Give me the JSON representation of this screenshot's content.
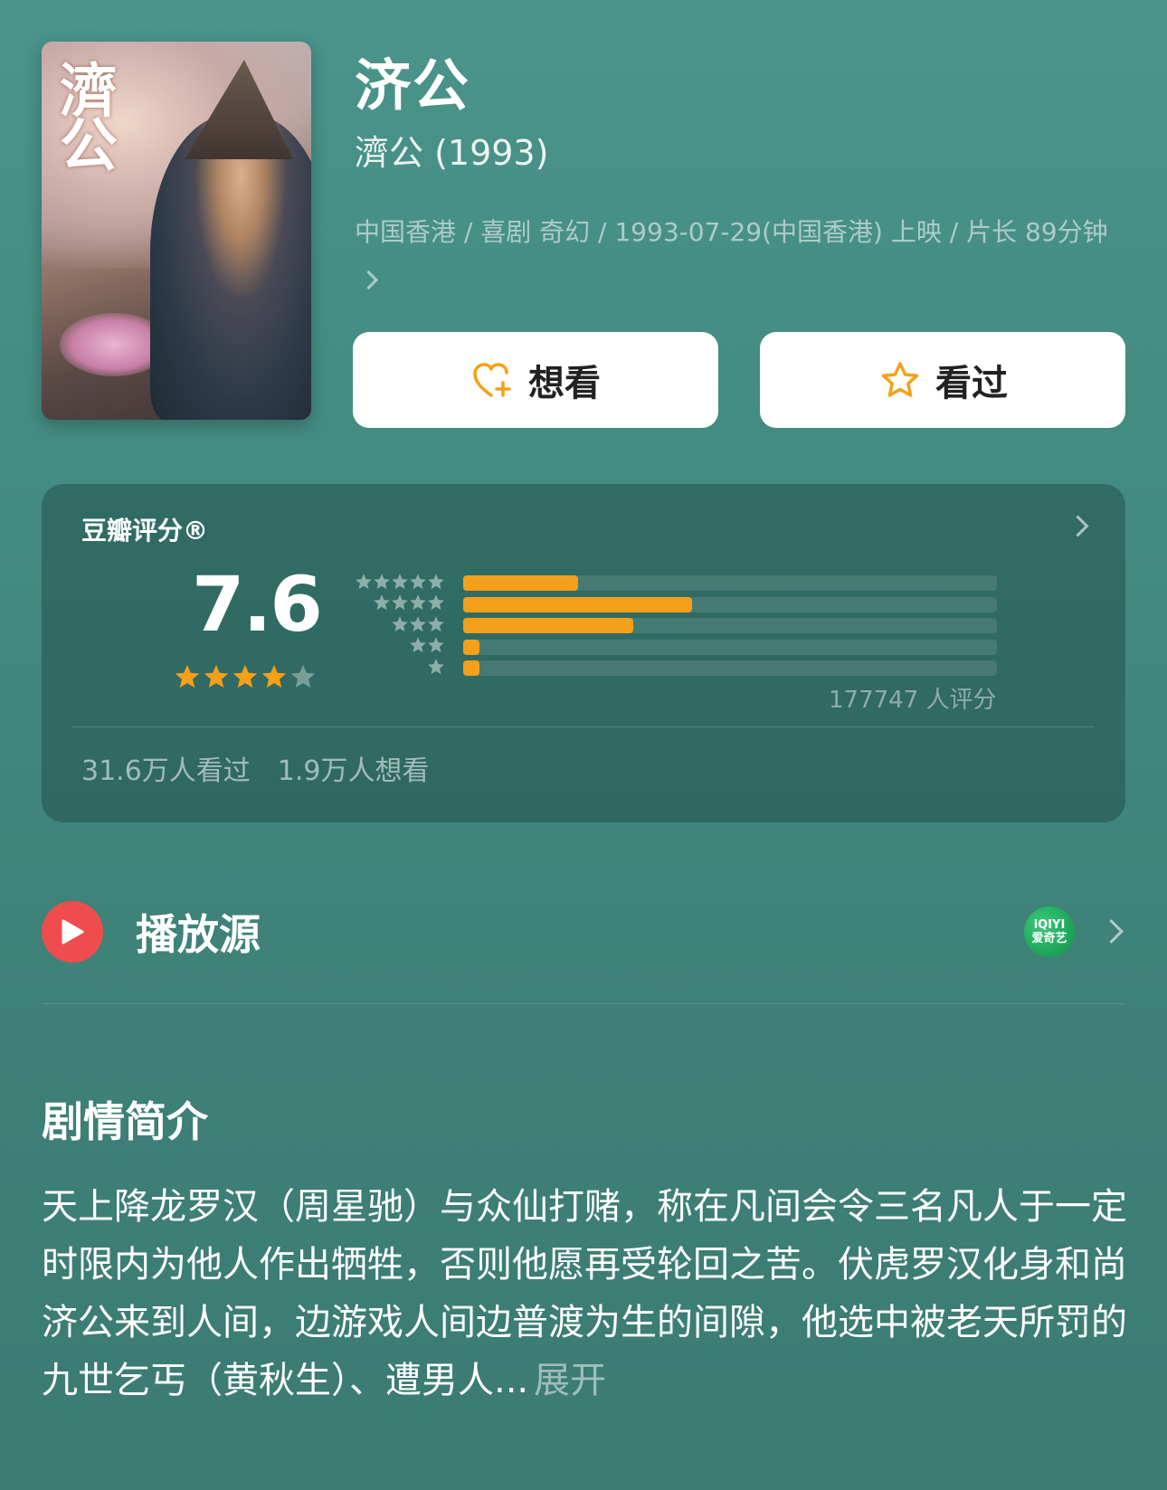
{
  "movie": {
    "title": "济公",
    "original_title": "濟公 (1993)",
    "meta_line": "中国香港 / 喜剧 奇幻 / 1993-07-29(中国香港) 上映 / 片长 89分钟",
    "poster_text": "濟公"
  },
  "actions": {
    "want_label": "想看",
    "seen_label": "看过",
    "want_icon": "heart-plus-icon",
    "seen_icon": "star-outline-icon",
    "icon_color": "#f5a01a"
  },
  "rating": {
    "label": "豆瓣评分®",
    "score": "7.6",
    "stars": 4,
    "max_stars": 5,
    "distribution": [
      {
        "stars": 5,
        "fraction": 0.215
      },
      {
        "stars": 4,
        "fraction": 0.428
      },
      {
        "stars": 3,
        "fraction": 0.318
      },
      {
        "stars": 2,
        "fraction": 0.03
      },
      {
        "stars": 1,
        "fraction": 0.03
      }
    ],
    "count_text": "177747 人评分",
    "seen_count": "31.6万人看过",
    "want_count": "1.9万人想看",
    "bar_color": "#f5a01a"
  },
  "source": {
    "label": "播放源",
    "provider_line1": "iQIYI",
    "provider_line2": "爱奇艺"
  },
  "synopsis": {
    "title": "剧情简介",
    "text": "天上降龙罗汉（周星驰）与众仙打赌，称在凡间会令三名凡人于一定时限内为他人作出牺牲，否则他愿再受轮回之苦。伏虎罗汉化身和尚济公来到人间，边游戏人间边普渡为生的间隙，他选中被老天所罚的九世乞丐（黄秋生）、遭男人...",
    "expand_label": "展开"
  }
}
